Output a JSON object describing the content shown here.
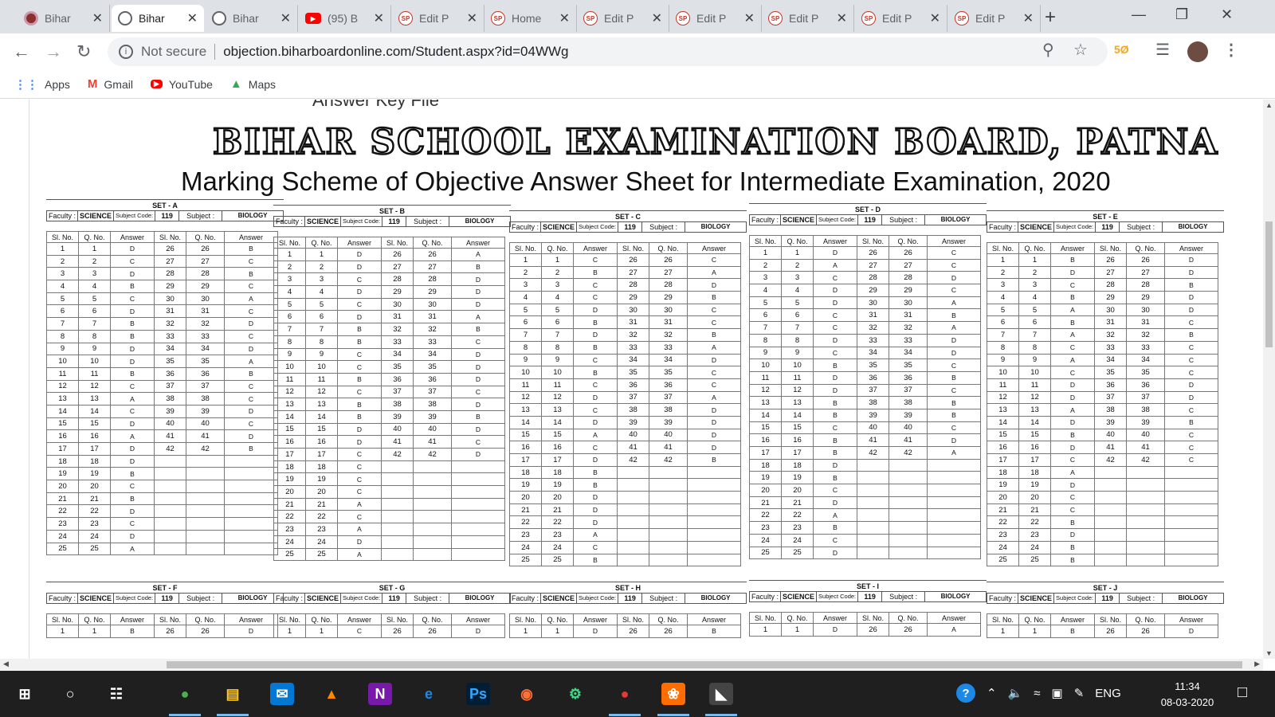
{
  "browser": {
    "tabs": [
      {
        "title": "Bihar",
        "icon": "record-icon",
        "active": false
      },
      {
        "title": "Bihar",
        "icon": "globe-icon",
        "active": true
      },
      {
        "title": "Bihar",
        "icon": "globe-icon",
        "active": false
      },
      {
        "title": "(95) B",
        "icon": "youtube-icon",
        "active": false
      },
      {
        "title": "Edit P",
        "icon": "sp-icon",
        "active": false
      },
      {
        "title": "Home",
        "icon": "sp-icon",
        "active": false
      },
      {
        "title": "Edit P",
        "icon": "sp-icon",
        "active": false
      },
      {
        "title": "Edit P",
        "icon": "sp-icon",
        "active": false
      },
      {
        "title": "Edit P",
        "icon": "sp-icon",
        "active": false
      },
      {
        "title": "Edit P",
        "icon": "sp-icon",
        "active": false
      },
      {
        "title": "Edit P",
        "icon": "sp-icon",
        "active": false
      }
    ],
    "security_label": "Not secure",
    "url": "objection.biharboardonline.com/Student.aspx?id=04WWg",
    "bookmarks": [
      {
        "label": "Apps",
        "icon": "apps-grid-icon"
      },
      {
        "label": "Gmail",
        "icon": "gmail-icon"
      },
      {
        "label": "YouTube",
        "icon": "youtube-icon"
      },
      {
        "label": "Maps",
        "icon": "maps-icon"
      }
    ]
  },
  "page": {
    "answer_key_label": "Answer Key File",
    "board_title": "BIHAR SCHOOL EXAMINATION BOARD, PATNA",
    "subtitle": "Marking Scheme of Objective Answer Sheet for Intermediate Examination, 2020",
    "meta_labels": {
      "faculty": "Faculty :",
      "faculty_value": "SCIENCE",
      "subject_code": "Subject Code:",
      "subject_code_value": "119",
      "subject": "Subject :",
      "subject_value": "BIOLOGY"
    },
    "col_headers": [
      "Sl. No.",
      "Q. No.",
      "Answer",
      "Sl. No.",
      "Q. No.",
      "Answer"
    ],
    "sets_top": [
      {
        "name": "SET - A",
        "answers": [
          "D",
          "C",
          "D",
          "B",
          "C",
          "D",
          "B",
          "B",
          "D",
          "D",
          "B",
          "C",
          "A",
          "C",
          "D",
          "A",
          "D",
          "D",
          "B",
          "C",
          "B",
          "D",
          "C",
          "D",
          "A",
          "B",
          "C",
          "B",
          "C",
          "A",
          "C",
          "D",
          "C",
          "D",
          "A",
          "B",
          "C",
          "C",
          "D",
          "C",
          "D",
          "B"
        ]
      },
      {
        "name": "SET - B",
        "answers": [
          "D",
          "D",
          "C",
          "D",
          "C",
          "D",
          "B",
          "B",
          "C",
          "C",
          "B",
          "C",
          "B",
          "B",
          "D",
          "D",
          "C",
          "C",
          "C",
          "C",
          "A",
          "C",
          "A",
          "D",
          "A",
          "A",
          "B",
          "D",
          "D",
          "D",
          "A",
          "B",
          "C",
          "D",
          "D",
          "D",
          "C",
          "D",
          "B",
          "D",
          "C",
          "D"
        ]
      },
      {
        "name": "SET - C",
        "answers": [
          "C",
          "B",
          "C",
          "C",
          "D",
          "B",
          "D",
          "B",
          "C",
          "B",
          "C",
          "D",
          "C",
          "D",
          "A",
          "C",
          "D",
          "B",
          "B",
          "D",
          "D",
          "D",
          "A",
          "C",
          "B",
          "C",
          "A",
          "D",
          "B",
          "C",
          "C",
          "B",
          "A",
          "D",
          "C",
          "C",
          "A",
          "D",
          "D",
          "D",
          "D",
          "B"
        ]
      },
      {
        "name": "SET - D",
        "answers": [
          "D",
          "A",
          "C",
          "D",
          "D",
          "C",
          "C",
          "D",
          "C",
          "B",
          "D",
          "D",
          "B",
          "B",
          "C",
          "B",
          "B",
          "D",
          "B",
          "C",
          "D",
          "A",
          "B",
          "C",
          "D",
          "C",
          "C",
          "D",
          "C",
          "A",
          "B",
          "A",
          "D",
          "D",
          "C",
          "B",
          "C",
          "B",
          "B",
          "C",
          "D",
          "A"
        ]
      },
      {
        "name": "SET - E",
        "answers": [
          "B",
          "D",
          "C",
          "B",
          "A",
          "B",
          "A",
          "C",
          "A",
          "C",
          "D",
          "D",
          "A",
          "D",
          "B",
          "D",
          "C",
          "A",
          "D",
          "C",
          "C",
          "B",
          "D",
          "B",
          "B",
          "D",
          "D",
          "B",
          "D",
          "D",
          "C",
          "B",
          "C",
          "C",
          "C",
          "D",
          "D",
          "C",
          "B",
          "C",
          "C",
          "C"
        ]
      }
    ],
    "sets_bottom": [
      {
        "name": "SET - F",
        "first_row": [
          "1",
          "1",
          "B",
          "26",
          "26",
          "D"
        ]
      },
      {
        "name": "SET - G",
        "first_row": [
          "1",
          "1",
          "C",
          "26",
          "26",
          "D"
        ]
      },
      {
        "name": "SET - H",
        "first_row": [
          "1",
          "1",
          "D",
          "26",
          "26",
          "B"
        ]
      },
      {
        "name": "SET - I",
        "first_row": [
          "1",
          "1",
          "D",
          "26",
          "26",
          "A"
        ]
      },
      {
        "name": "SET - J",
        "first_row": [
          "1",
          "1",
          "B",
          "26",
          "26",
          "D"
        ]
      }
    ]
  },
  "taskbar": {
    "apps": [
      "start-icon",
      "cortana-icon",
      "task-view-icon",
      "chrome-icon",
      "file-explorer-icon",
      "mail-icon",
      "vlc-icon",
      "onenote-icon",
      "edge-icon",
      "photoshop-icon",
      "firefox-icon",
      "android-studio-icon",
      "chrome-profile-icon",
      "uc-browser-icon",
      "photos-icon"
    ],
    "language": "ENG",
    "time": "11:34",
    "date": "08-03-2020"
  }
}
